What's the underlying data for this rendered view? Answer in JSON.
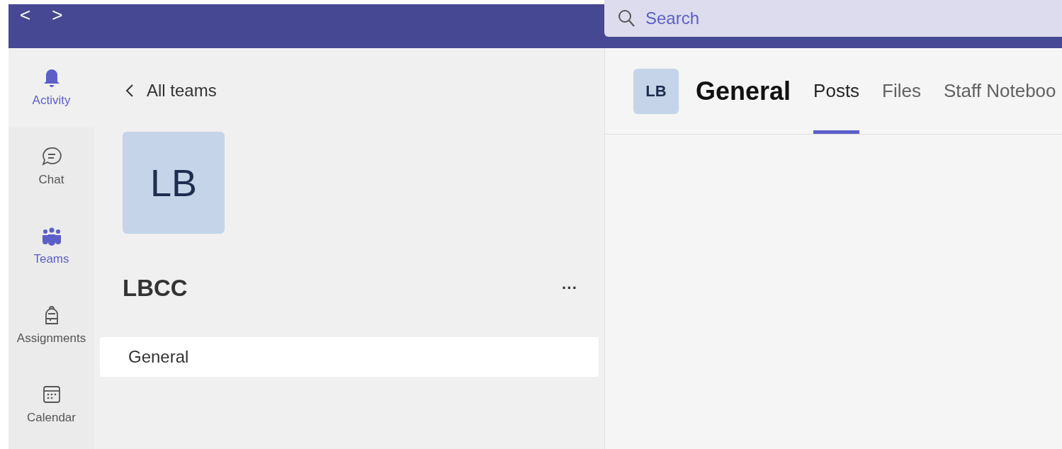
{
  "nav": {
    "back": "<",
    "forward": ">"
  },
  "search": {
    "placeholder": "Search"
  },
  "rail": [
    {
      "label": "Activity",
      "kind": "bell",
      "selected": true
    },
    {
      "label": "Chat",
      "kind": "chat",
      "selected": false
    },
    {
      "label": "Teams",
      "kind": "teams",
      "selected": true
    },
    {
      "label": "Assignments",
      "kind": "backpack",
      "selected": false
    },
    {
      "label": "Calendar",
      "kind": "calendar",
      "selected": false
    }
  ],
  "panel": {
    "back_label": "All teams",
    "team_initials": "LB",
    "team_name": "LBCC",
    "more": "···",
    "channels": [
      {
        "label": "General",
        "selected": true
      }
    ]
  },
  "channel_header": {
    "initials": "LB",
    "title": "General",
    "tabs": [
      {
        "label": "Posts",
        "selected": true
      },
      {
        "label": "Files",
        "selected": false
      },
      {
        "label": "Staff Noteboo",
        "selected": false
      }
    ]
  }
}
